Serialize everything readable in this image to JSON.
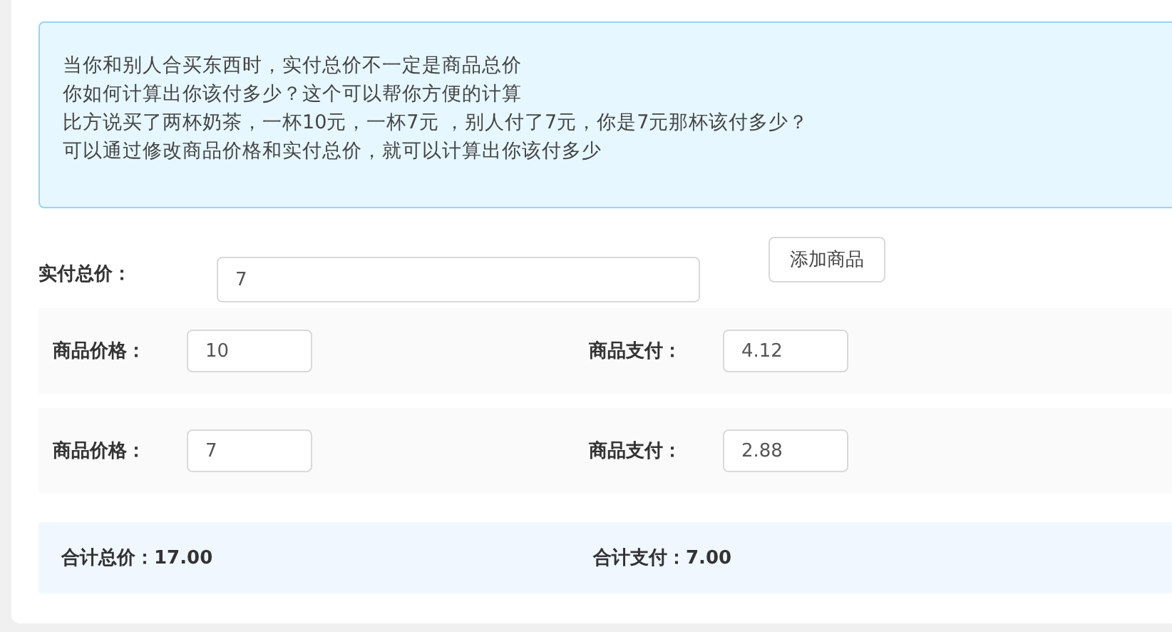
{
  "intro": [
    "当你和别人合买东西时，实付总价不一定是商品总价",
    "你如何计算出你该付多少？这个可以帮你方便的计算",
    "比方说买了两杯奶茶，一杯10元，一杯7元 ，别人付了7元，你是7元那杯该付多少？",
    "可以通过修改商品价格和实付总价，就可以计算出你该付多少"
  ],
  "total": {
    "label": "实付总价：",
    "value": "7"
  },
  "add_button": "添加商品",
  "items": [
    {
      "price_label": "商品价格：",
      "price": "10",
      "pay_label": "商品支付：",
      "pay": "4.12"
    },
    {
      "price_label": "商品价格：",
      "price": "7",
      "pay_label": "商品支付：",
      "pay": "2.88"
    }
  ],
  "summary": [
    "合计总价：17.00",
    "合计支付：7.00"
  ]
}
